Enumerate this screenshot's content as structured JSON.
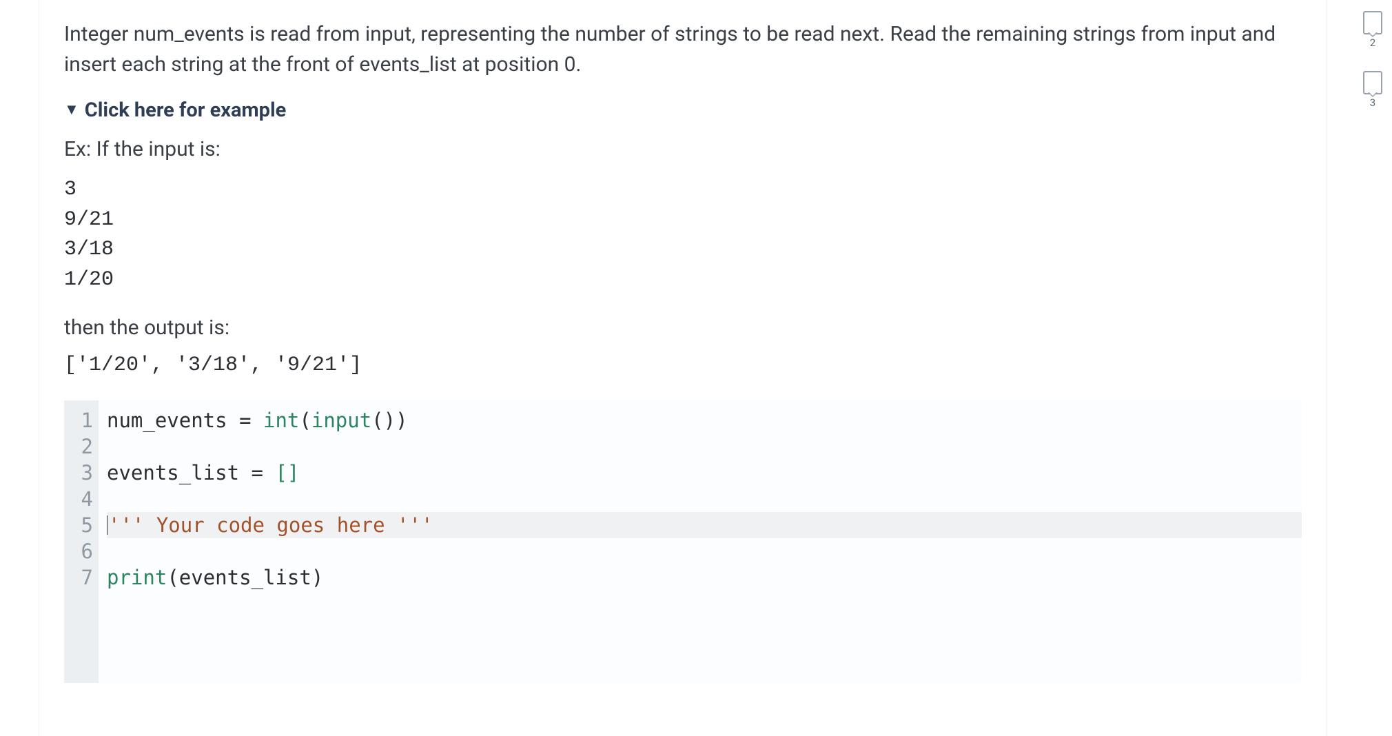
{
  "prompt": "Integer num_events is read from input, representing the number of strings to be read next. Read the remaining strings from input and insert each string at the front of events_list at position 0.",
  "example_toggle": "Click here for example",
  "example": {
    "lead": "Ex: If the input is:",
    "input_lines": [
      "3",
      "9/21",
      "3/18",
      "1/20"
    ],
    "then": "then the output is:",
    "output": "['1/20', '3/18', '9/21']"
  },
  "code": {
    "lines": [
      {
        "n": 1,
        "tokens": [
          {
            "t": "num_events ",
            "c": "var"
          },
          {
            "t": "=",
            "c": "op"
          },
          {
            "t": " ",
            "c": "var"
          },
          {
            "t": "int",
            "c": "kw"
          },
          {
            "t": "(",
            "c": "var"
          },
          {
            "t": "input",
            "c": "fn"
          },
          {
            "t": "())",
            "c": "var"
          }
        ]
      },
      {
        "n": 2,
        "tokens": []
      },
      {
        "n": 3,
        "tokens": [
          {
            "t": "events_list ",
            "c": "var"
          },
          {
            "t": "=",
            "c": "op"
          },
          {
            "t": " ",
            "c": "var"
          },
          {
            "t": "[]",
            "c": "brk"
          }
        ]
      },
      {
        "n": 4,
        "tokens": []
      },
      {
        "n": 5,
        "hl": true,
        "cursor": true,
        "tokens": [
          {
            "t": "''' Your code goes here '''",
            "c": "str"
          }
        ]
      },
      {
        "n": 6,
        "tokens": []
      },
      {
        "n": 7,
        "tokens": [
          {
            "t": "print",
            "c": "fn"
          },
          {
            "t": "(events_list)",
            "c": "var"
          }
        ]
      }
    ]
  },
  "marks": [
    {
      "label": "2"
    },
    {
      "label": "3"
    }
  ]
}
